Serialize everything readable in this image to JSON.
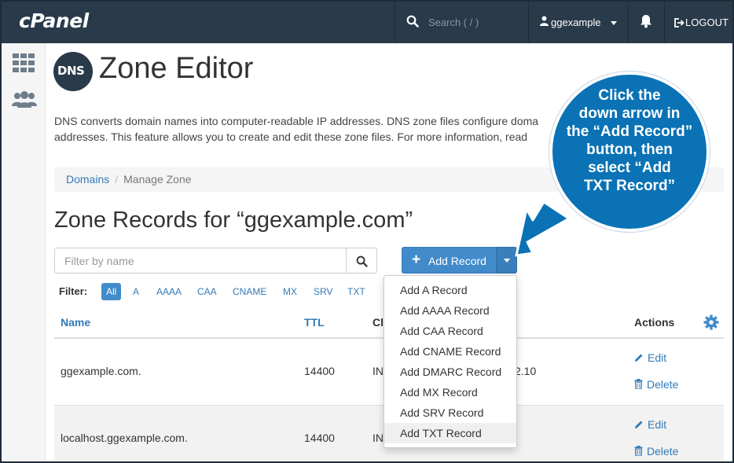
{
  "brand": {
    "logo_text": "cPanel"
  },
  "topbar": {
    "search_placeholder": "Search ( / )",
    "username": "ggexample",
    "logout_label": "LOGOUT"
  },
  "sidebar": {
    "items": [
      {
        "icon": "apps-grid-icon"
      },
      {
        "icon": "users-icon"
      }
    ]
  },
  "page": {
    "logo_text": "DNS",
    "title": "Zone Editor",
    "description_line1": "DNS converts domain names into computer-readable IP addresses. DNS zone files configure doma",
    "description_line2": "addresses. This feature allows you to create and edit these zone files. For more information, read"
  },
  "breadcrumb": {
    "root": "Domains",
    "separator": "/",
    "current": "Manage Zone"
  },
  "zone": {
    "title": "Zone Records for “ggexample.com”",
    "filter_placeholder": "Filter by name",
    "add_record_label": "Add Record"
  },
  "filters": {
    "label": "Filter:",
    "items": [
      "All",
      "A",
      "AAAA",
      "CAA",
      "CNAME",
      "MX",
      "SRV",
      "TXT"
    ],
    "active": "All"
  },
  "table": {
    "headers": {
      "name": "Name",
      "ttl": "TTL",
      "class": "Cl",
      "actions": "Actions"
    },
    "rows": [
      {
        "name": "ggexample.com.",
        "ttl": "14400",
        "class": "IN",
        "record_tail": "2.10",
        "edit": "Edit",
        "delete": "Delete"
      },
      {
        "name": "localhost.ggexample.com.",
        "ttl": "14400",
        "class": "IN",
        "edit": "Edit",
        "delete": "Delete"
      }
    ]
  },
  "dropdown": {
    "items": [
      "Add A Record",
      "Add AAAA Record",
      "Add CAA Record",
      "Add CNAME Record",
      "Add DMARC Record",
      "Add MX Record",
      "Add SRV Record",
      "Add TXT Record"
    ],
    "highlighted": "Add TXT Record"
  },
  "callout": {
    "lines": [
      "Click the",
      "down arrow in",
      "the “Add Record”",
      "button, then",
      "select “Add",
      "TXT Record”"
    ],
    "color": "#0a72b5"
  },
  "colors": {
    "topbar": "#293a4a",
    "primary": "#428bca",
    "link": "#337ab7"
  }
}
